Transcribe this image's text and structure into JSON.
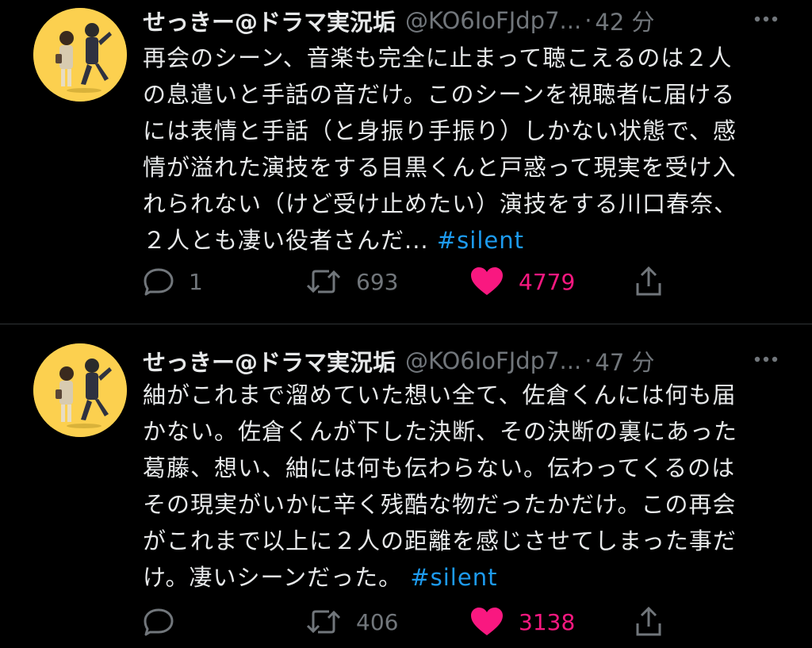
{
  "colors": {
    "background": "#000000",
    "text": "#e7e9ea",
    "muted": "#71767b",
    "hashtag": "#1d9bf0",
    "like": "#f91880",
    "avatar_bg": "#fcd04f"
  },
  "tweets": [
    {
      "display_name": "せっきー@ドラマ実況垢",
      "handle": "@KO6IoFJdp7...",
      "separator": "·",
      "time": "42 分",
      "text_lines": [
        "再会のシーン、音楽も完全に止まって聴こえるのは２人",
        "の息遣いと手話の音だけ。このシーンを視聴者に届ける",
        "には表情と手話（と身振り手振り）しかない状態で、感",
        "情が溢れた演技をする目黒くんと戸惑って現実を受け入",
        "れられない（けど受け止めたい）演技をする川口春奈、"
      ],
      "last_line": "２人とも凄い役者さんだ... ",
      "hashtag": "#silent",
      "reply_count": "1",
      "retweet_count": "693",
      "like_count": "4779",
      "icons": {
        "avatar": "avatar-icon",
        "more": "more-icon",
        "reply": "reply-icon",
        "retweet": "retweet-icon",
        "like": "heart-icon",
        "share": "share-icon"
      }
    },
    {
      "display_name": "せっきー@ドラマ実況垢",
      "handle": "@KO6IoFJdp7...",
      "separator": "·",
      "time": "47 分",
      "text_lines": [
        "紬がこれまで溜めていた想い全て、佐倉くんには何も届",
        "かない。佐倉くんが下した決断、その決断の裏にあった",
        "葛藤、想い、紬には何も伝わらない。伝わってくるのは",
        "その現実がいかに辛く残酷な物だったかだけ。この再会",
        "がこれまで以上に２人の距離を感じさせてしまった事だ"
      ],
      "last_line": "け。凄いシーンだった。 ",
      "hashtag": "#silent",
      "reply_count": "",
      "retweet_count": "406",
      "like_count": "3138",
      "icons": {
        "avatar": "avatar-icon",
        "more": "more-icon",
        "reply": "reply-icon",
        "retweet": "retweet-icon",
        "like": "heart-icon",
        "share": "share-icon"
      }
    }
  ]
}
